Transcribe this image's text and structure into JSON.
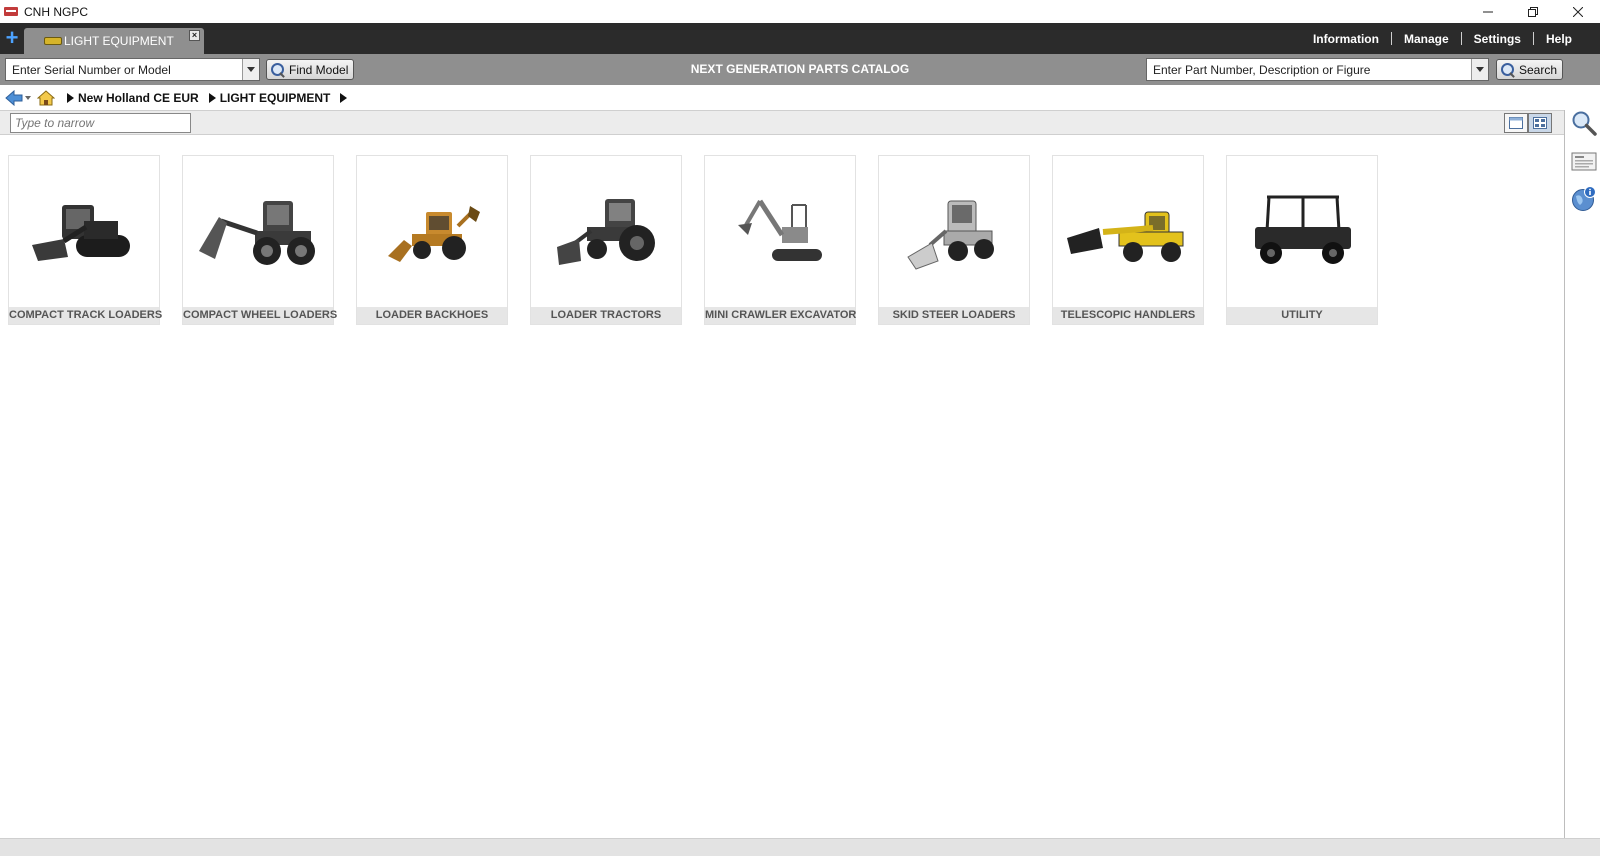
{
  "window": {
    "title": "CNH NGPC",
    "controls": [
      "minimize-icon",
      "restore-icon",
      "close-icon"
    ]
  },
  "tabbar": {
    "add_tab_icon": "plus-icon",
    "active_tab": {
      "label": "LIGHT EQUIPMENT",
      "icon": "loader-icon",
      "close_icon": "close-icon"
    },
    "menu": [
      "Information",
      "Manage",
      "Settings",
      "Help"
    ]
  },
  "searchbar": {
    "model_input": {
      "value": "Enter Serial Number or Model"
    },
    "find_model_label": "Find Model",
    "center_title": "NEXT GENERATION PARTS CATALOG",
    "part_input": {
      "value": "Enter Part Number, Description or Figure"
    },
    "search_label": "Search"
  },
  "breadcrumb": {
    "back_icon": "back-arrow-icon",
    "home_icon": "home-icon",
    "items": [
      "New Holland CE EUR",
      "LIGHT EQUIPMENT"
    ]
  },
  "filter": {
    "placeholder": "Type to narrow",
    "view_icons": [
      "list-view-icon",
      "grid-view-icon"
    ]
  },
  "rail": [
    "search-icon",
    "news-icon",
    "globe-info-icon"
  ],
  "categories": [
    {
      "label": "COMPACT TRACK LOADERS",
      "icon": "compact-track-loader-icon",
      "color": "#2a2a2a"
    },
    {
      "label": "COMPACT WHEEL LOADERS",
      "icon": "compact-wheel-loader-icon",
      "color": "#3a3a3a"
    },
    {
      "label": "LOADER BACKHOES",
      "icon": "loader-backhoe-icon",
      "color": "#c88a2e"
    },
    {
      "label": "LOADER TRACTORS",
      "icon": "loader-tractor-icon",
      "color": "#3a3a3a"
    },
    {
      "label": "MINI CRAWLER EXCAVATOR",
      "icon": "mini-excavator-icon",
      "color": "#8a8a8a"
    },
    {
      "label": "SKID STEER LOADERS",
      "icon": "skid-steer-loader-icon",
      "color": "#9a9a9a"
    },
    {
      "label": "TELESCOPIC HANDLERS",
      "icon": "telehandler-icon",
      "color": "#e3c21c"
    },
    {
      "label": "UTILITY",
      "icon": "utility-vehicle-icon",
      "color": "#222222"
    }
  ],
  "colors": {
    "tabbar_bg": "#2b2b2b",
    "toolbar_bg": "#8f8f8f",
    "accent_blue": "#4da3ff"
  }
}
